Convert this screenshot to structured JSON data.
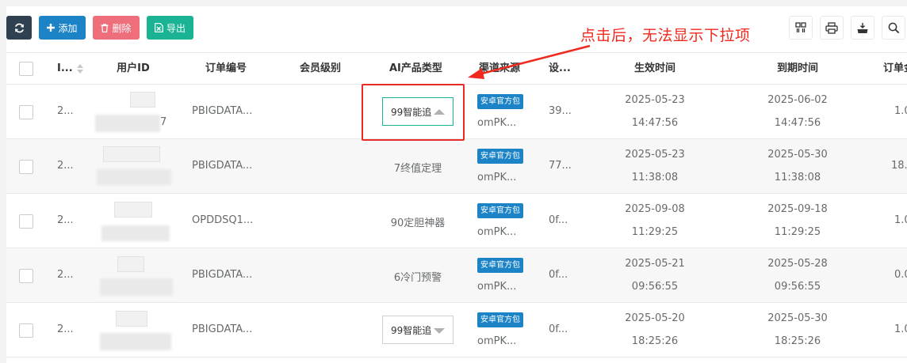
{
  "toolbar": {
    "refresh_icon": "refresh-icon",
    "add_label": "添加",
    "delete_label": "删除",
    "export_label": "导出",
    "right_tools": [
      "columns-icon",
      "print-icon",
      "export-tools-icon",
      "search-icon"
    ]
  },
  "annotation": {
    "text": "点击后，无法显示下拉项",
    "color": "#f0291f"
  },
  "table": {
    "headers": {
      "id": "I...",
      "user_id": "用户ID",
      "order_no": "订单编号",
      "member_level": "会员级别",
      "ai_type": "AI产品类型",
      "channel": "渠道来源",
      "device": "设...",
      "start_time": "生效时间",
      "end_time": "到期时间",
      "order_amount": "订单金"
    },
    "rows": [
      {
        "id": "2...",
        "user_suffix": "7",
        "order_no": "PBIGDATA...",
        "ai_type": "99智能追",
        "ai_is_select": true,
        "channel_tag": "安卓官方包",
        "channel_src": "omPK...",
        "device": "39...",
        "start_date": "2025-05-23",
        "start_time": "14:47:56",
        "end_date": "2025-06-02",
        "end_time": "14:47:56",
        "amount": "1.0"
      },
      {
        "id": "2...",
        "user_suffix": "",
        "order_no": "PBIGDATA...",
        "ai_type": "7终值定理",
        "ai_is_select": false,
        "channel_tag": "安卓官方包",
        "channel_src": "omPK...",
        "device": "77...",
        "start_date": "2025-05-23",
        "start_time": "11:38:08",
        "end_date": "2025-05-30",
        "end_time": "11:38:08",
        "amount": "18."
      },
      {
        "id": "2...",
        "user_suffix": "",
        "order_no": "OPDDSQ1...",
        "ai_type": "90定胆神器",
        "ai_is_select": false,
        "channel_tag": "安卓官方包",
        "channel_src": "omPK...",
        "device": "0f...",
        "start_date": "2025-09-08",
        "start_time": "11:29:25",
        "end_date": "2025-09-18",
        "end_time": "11:29:25",
        "amount": "1.0"
      },
      {
        "id": "2...",
        "user_suffix": "",
        "order_no": "PBIGDATA...",
        "ai_type": "6冷门预警",
        "ai_is_select": false,
        "channel_tag": "安卓官方包",
        "channel_src": "omPK...",
        "device": "0f...",
        "start_date": "2025-05-21",
        "start_time": "09:56:55",
        "end_date": "2025-05-28",
        "end_time": "09:56:55",
        "amount": "0.0"
      },
      {
        "id": "2...",
        "user_suffix": "",
        "order_no": "PBIGDATA...",
        "ai_type": "99智能追",
        "ai_is_select": true,
        "channel_tag": "安卓官方包",
        "channel_src": "omPK...",
        "device": "0f...",
        "start_date": "2025-05-20",
        "start_time": "18:25:26",
        "end_date": "2025-05-30",
        "end_time": "18:25:26",
        "amount": "1.0"
      }
    ]
  },
  "colors": {
    "add": "#1c84c6",
    "delete": "#ed5565",
    "export": "#1ab394",
    "refresh": "#2f4050",
    "highlight_box": "#ea2a24"
  }
}
